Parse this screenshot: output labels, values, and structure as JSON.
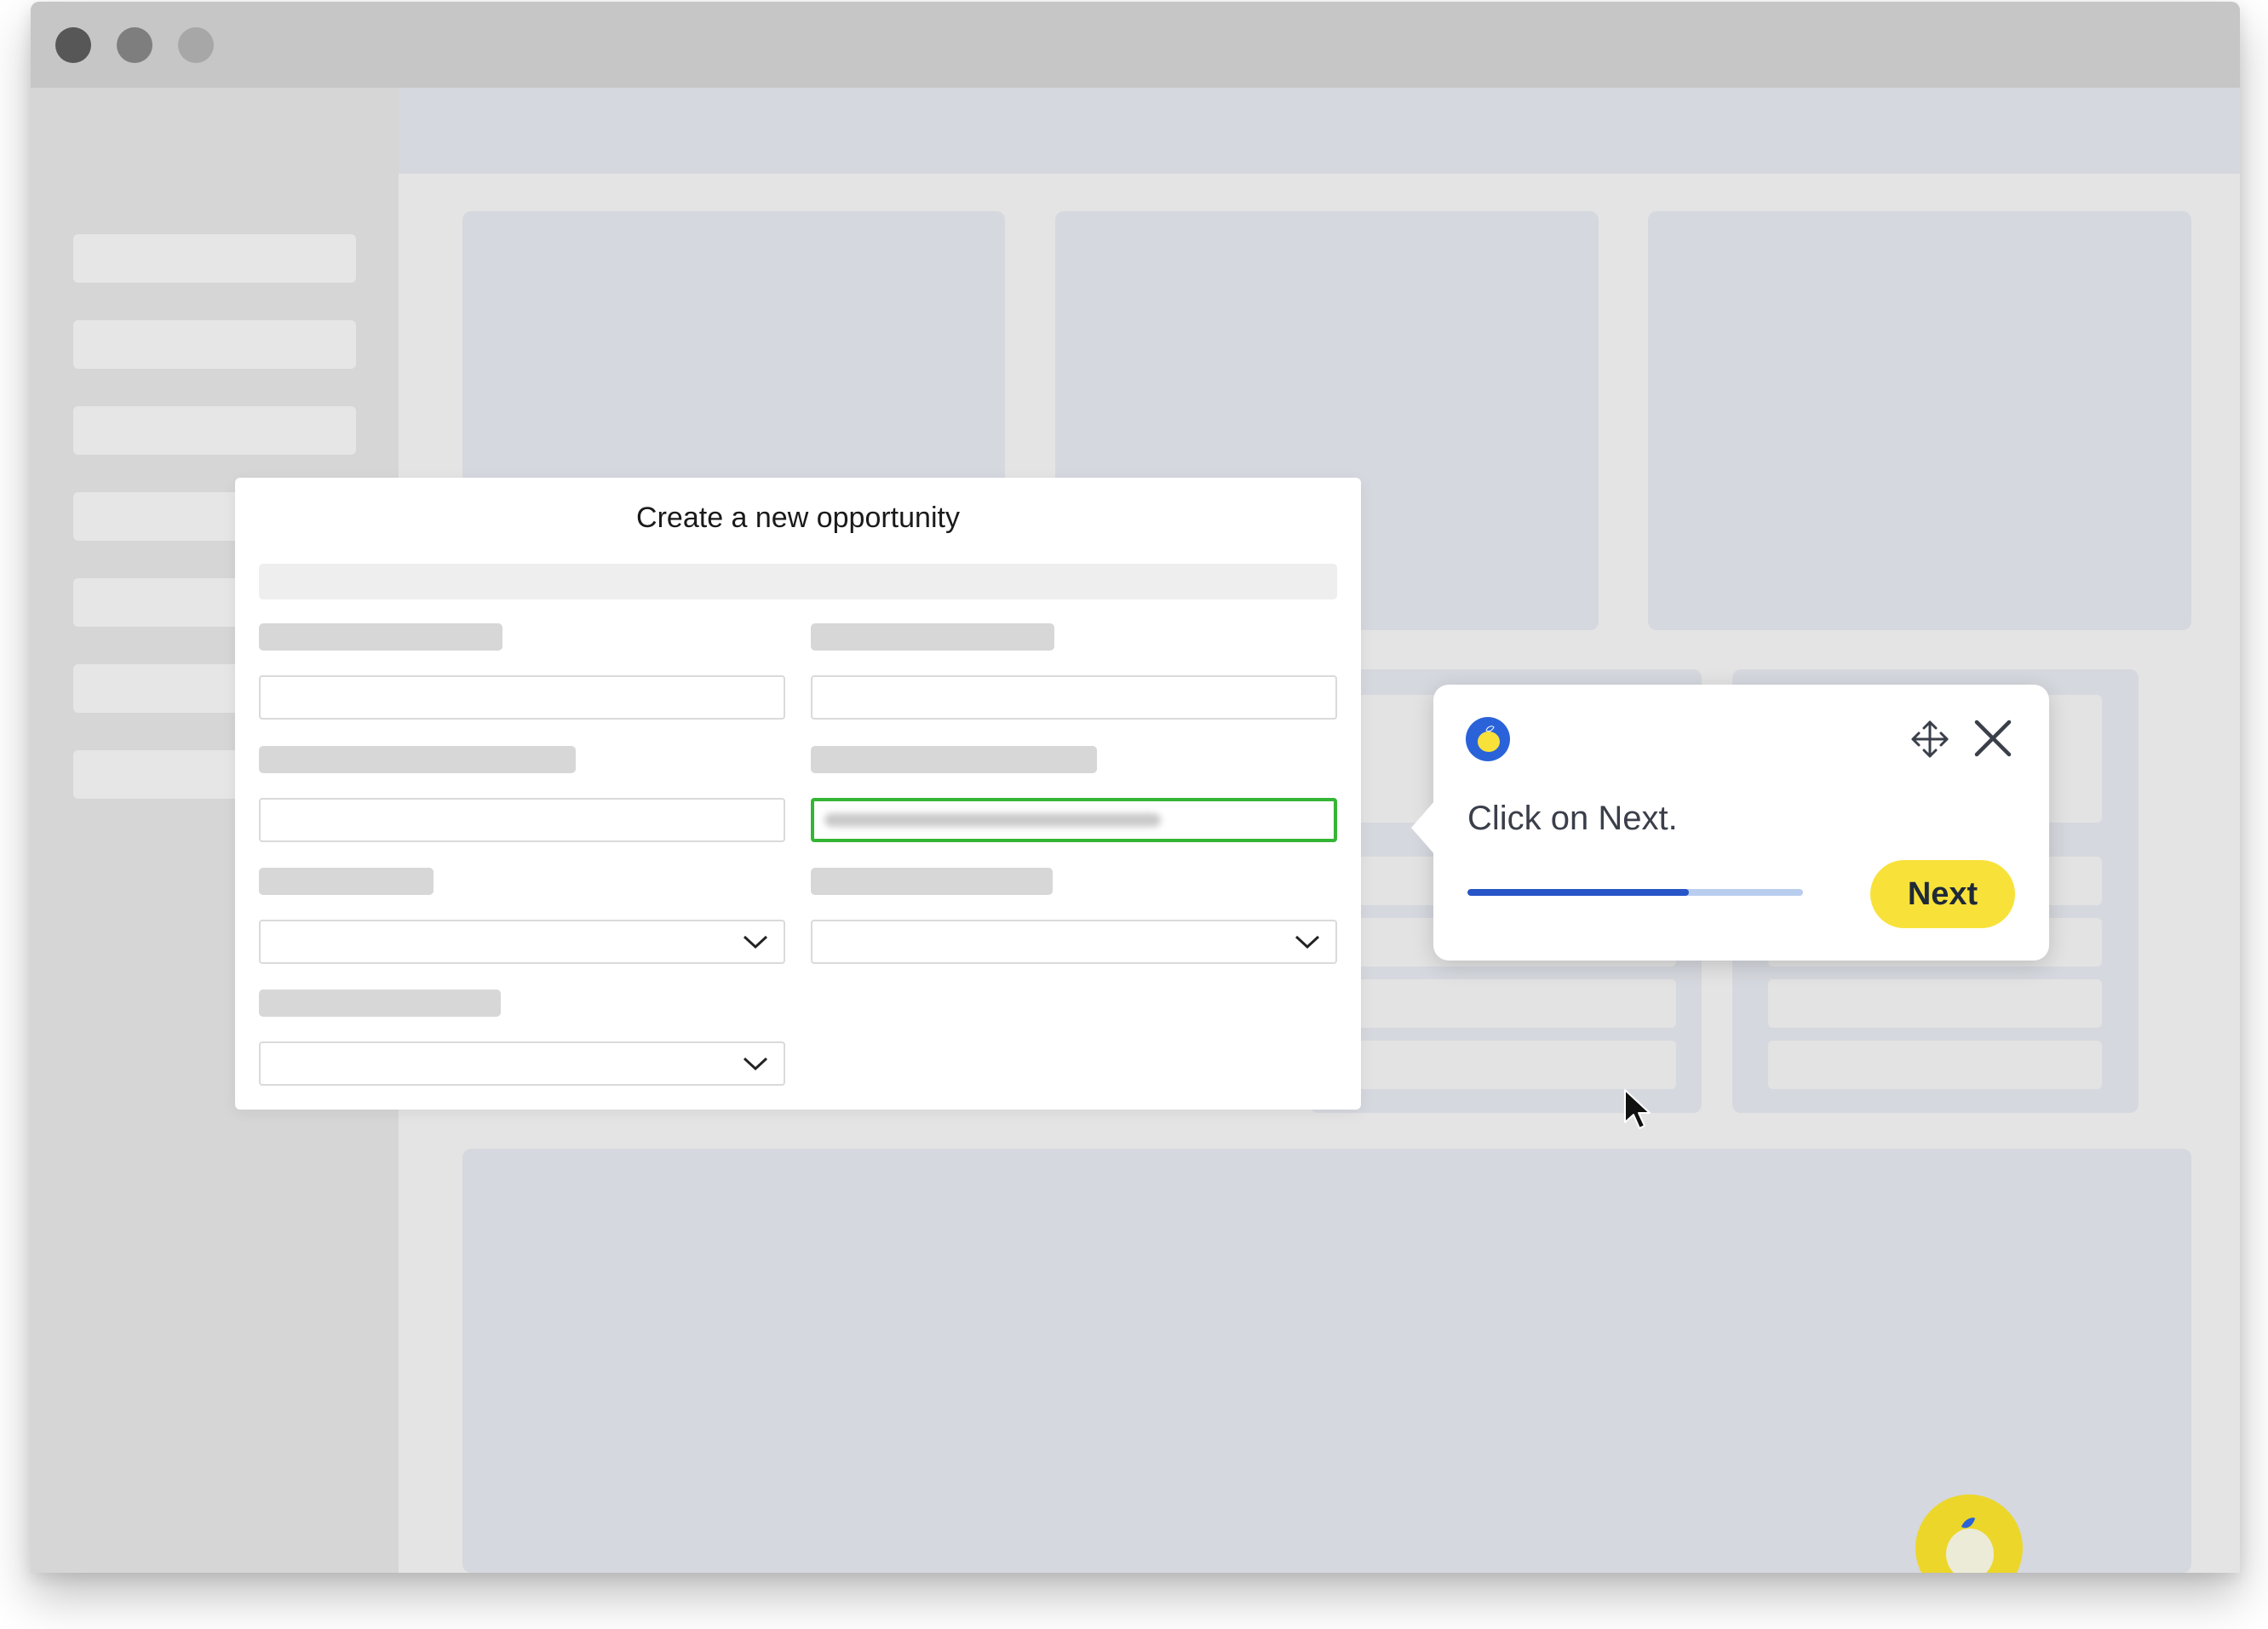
{
  "modal": {
    "title": "Create a new opportunity"
  },
  "guide_tooltip": {
    "instruction": "Click on Next.",
    "next_label": "Next",
    "progress": 0.66,
    "colors": {
      "accent_yellow": "#f8e23a",
      "progress_fill": "#2755c8",
      "progress_track": "#b9ceee",
      "focus_highlight": "#35b535"
    },
    "icons": [
      "lemon-logo-icon",
      "move-icon",
      "close-icon"
    ]
  }
}
